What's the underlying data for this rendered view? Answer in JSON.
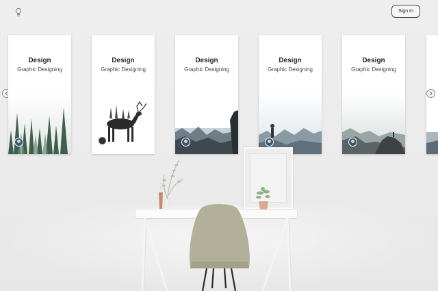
{
  "header": {
    "logo_icon": "lightbulb-icon",
    "signin_label": "Sign In"
  },
  "carousel": {
    "prev_icon": "chevron-left-icon",
    "next_icon": "chevron-right-icon",
    "cards": [
      {
        "title": "Design",
        "subtitle": "Graphic Designing",
        "scene": "misty pine forest"
      },
      {
        "title": "Design",
        "subtitle": "Graphic Designing",
        "scene": "deer silhouette"
      },
      {
        "title": "Design",
        "subtitle": "Graphic Designing",
        "scene": "mountain valley with person"
      },
      {
        "title": "Design",
        "subtitle": "Graphic Designing",
        "scene": "hiker on mountain peaks"
      },
      {
        "title": "Design",
        "subtitle": "Graphic Designing",
        "scene": "hiker on rocky summit"
      }
    ]
  },
  "colors": {
    "background": "#ececec",
    "card": "#ffffff",
    "text": "#222222"
  }
}
